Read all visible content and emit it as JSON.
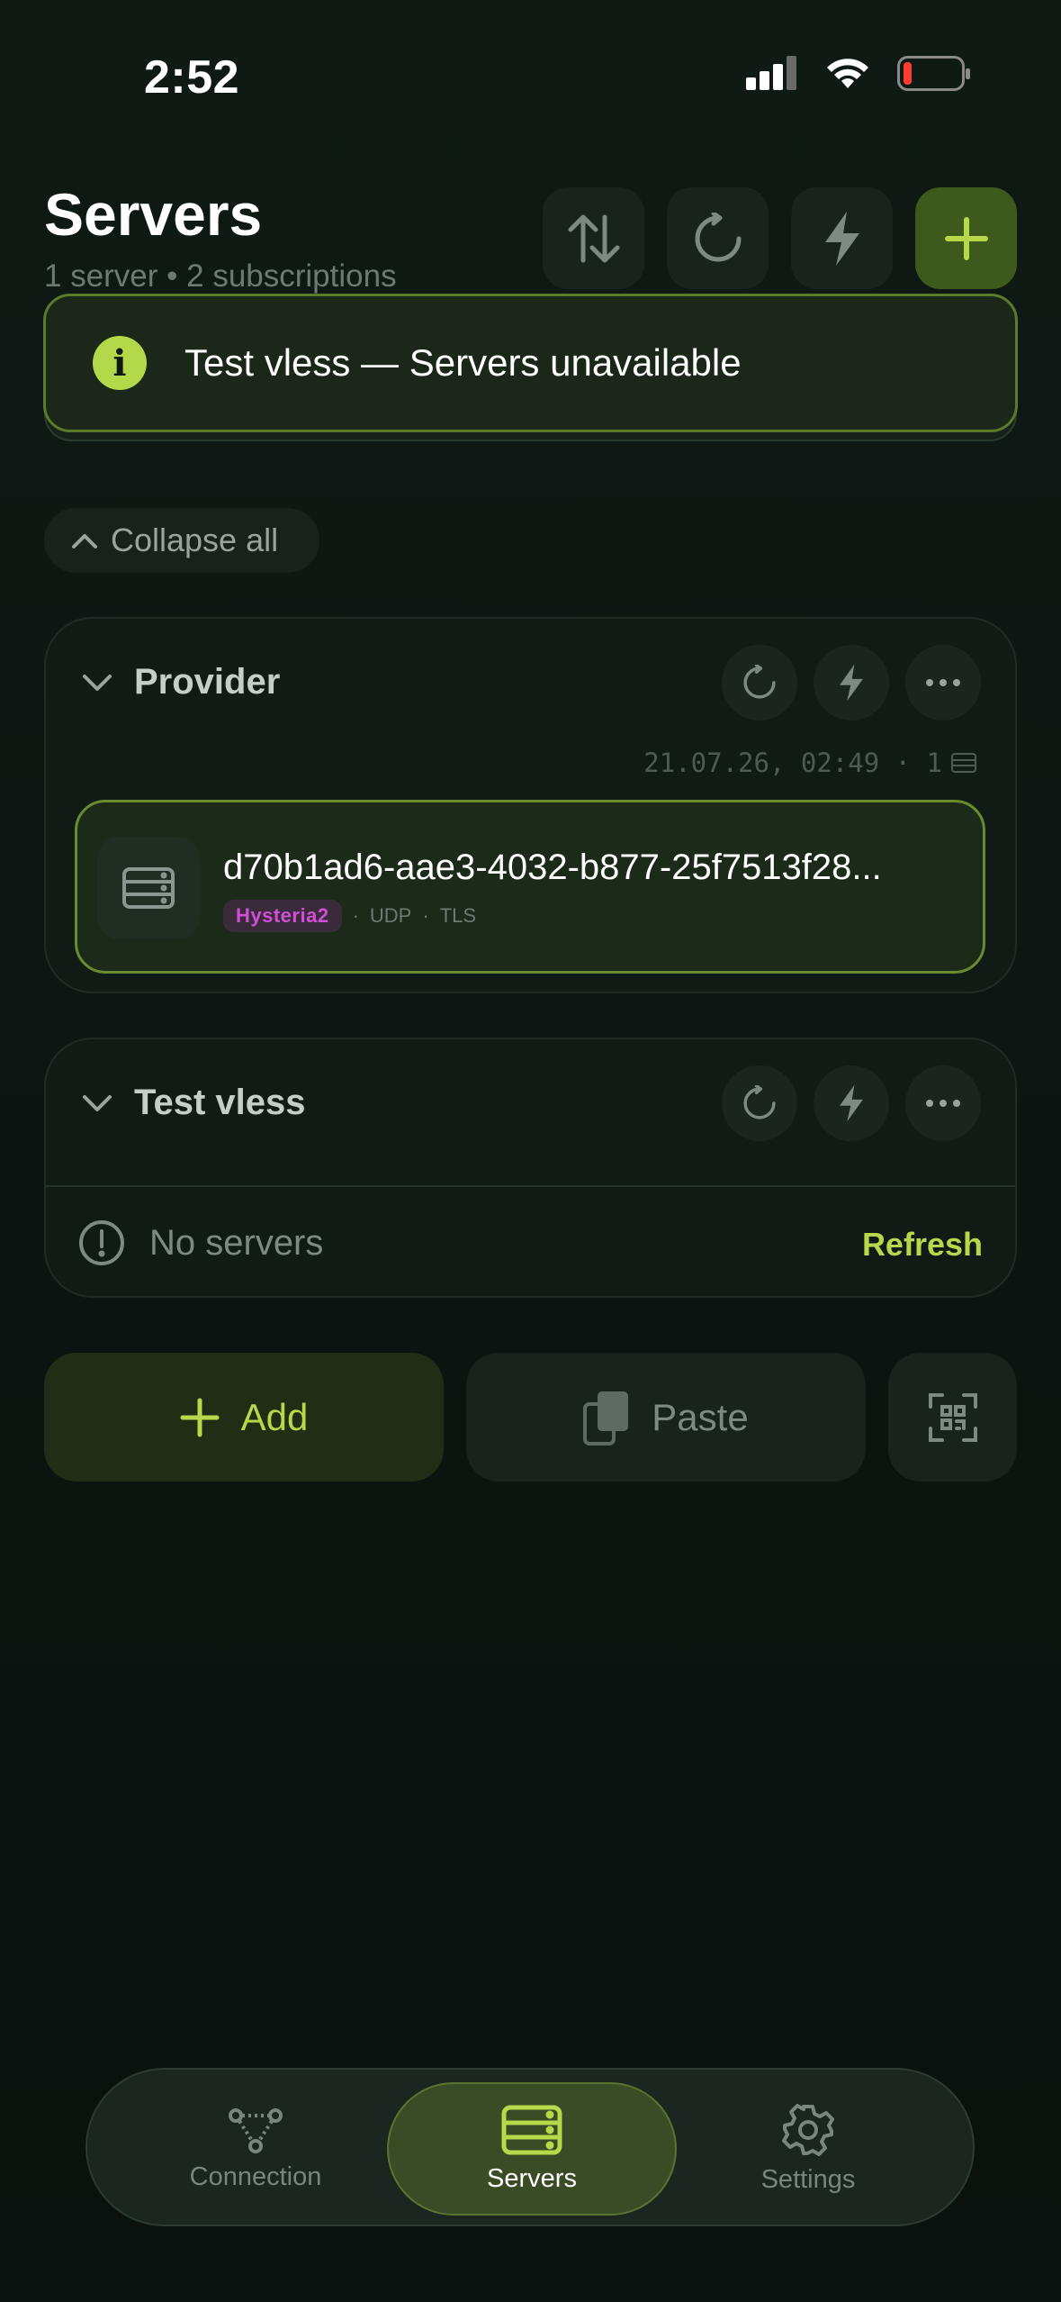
{
  "status_bar": {
    "time": "2:52"
  },
  "header": {
    "title": "Servers",
    "subtitle": "1 server • 2 subscriptions",
    "buttons": [
      "sort",
      "refresh",
      "ping",
      "add"
    ]
  },
  "toast": {
    "icon": "info-icon",
    "text": "Test vless — Servers unavailable"
  },
  "collapse_all": {
    "label": "Collapse all"
  },
  "groups": [
    {
      "name": "Provider",
      "meta": "21.07.26, 02:49 · 1",
      "servers": [
        {
          "name": "d70b1ad6-aae3-4032-b877-25f7513f28...",
          "protocol": "Hysteria2",
          "transport": "UDP",
          "security": "TLS"
        }
      ]
    },
    {
      "name": "Test vless",
      "empty_text": "No servers",
      "refresh_label": "Refresh"
    }
  ],
  "actions": {
    "add_label": "Add",
    "paste_label": "Paste",
    "scan_icon": "qr-scan-icon"
  },
  "tabbar": {
    "tabs": [
      {
        "label": "Connection",
        "icon": "connection-icon",
        "active": false
      },
      {
        "label": "Servers",
        "icon": "servers-icon",
        "active": true
      },
      {
        "label": "Settings",
        "icon": "gear-icon",
        "active": false
      }
    ]
  },
  "colors": {
    "accent": "#b6d84a",
    "background": "#0d1612",
    "protocol_badge": "#d04ed8"
  }
}
